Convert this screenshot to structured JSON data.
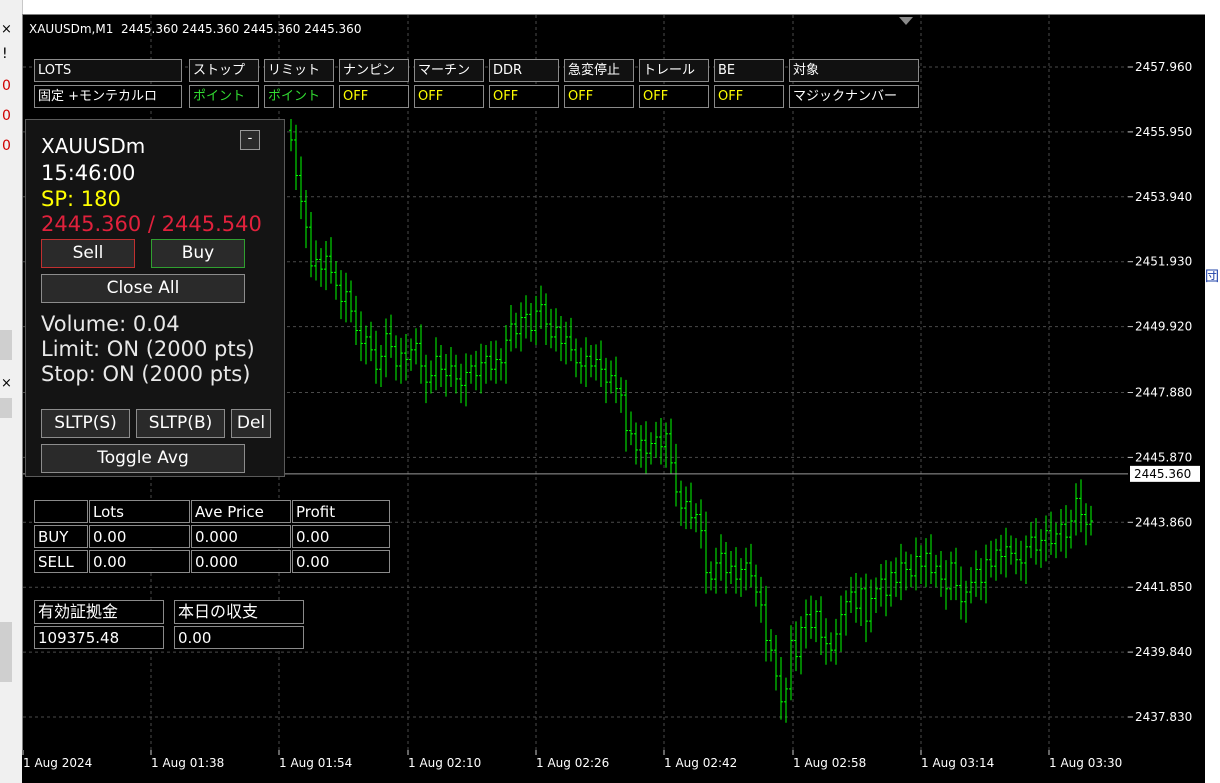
{
  "title_bar": "XAUUSDm,M1  2445.360 2445.360 2445.360 2445.360",
  "toolbar": [
    {
      "label": "LOTS",
      "value": "固定 +モンテカルロ",
      "value_color": "white"
    },
    {
      "label": "ストップ",
      "value": "ポイント",
      "value_color": "green"
    },
    {
      "label": "リミット",
      "value": "ポイント",
      "value_color": "green"
    },
    {
      "label": "ナンピン",
      "value": "OFF",
      "value_color": "yellow"
    },
    {
      "label": "マーチン",
      "value": "OFF",
      "value_color": "yellow"
    },
    {
      "label": "DDR",
      "value": "OFF",
      "value_color": "yellow"
    },
    {
      "label": "急変停止",
      "value": "OFF",
      "value_color": "yellow"
    },
    {
      "label": "トレール",
      "value": "OFF",
      "value_color": "yellow"
    },
    {
      "label": "BE",
      "value": "OFF",
      "value_color": "yellow"
    },
    {
      "label": "対象",
      "value": "マジックナンバー",
      "value_color": "white"
    }
  ],
  "panel": {
    "symbol": "XAUUSDm",
    "minimize_label": "-",
    "time": "15:46:00",
    "spread": "SP: 180",
    "bid_ask": "2445.360 / 2445.540",
    "sell_label": "Sell",
    "buy_label": "Buy",
    "close_all_label": "Close All",
    "volume": "Volume: 0.04",
    "limit": "Limit: ON (2000 pts)",
    "stop": "Stop: ON (2000 pts)",
    "sltp_s_label": "SLTP(S)",
    "sltp_b_label": "SLTP(B)",
    "del_label": "Del",
    "toggle_avg_label": "Toggle Avg"
  },
  "positions": {
    "headers": [
      "",
      "Lots",
      "Ave Price",
      "Profit"
    ],
    "rows": [
      [
        "BUY",
        "0.00",
        "0.000",
        "0.00"
      ],
      [
        "SELL",
        "0.00",
        "0.000",
        "0.00"
      ]
    ]
  },
  "account": {
    "margin_label": "有効証拠金",
    "margin_value": "109375.48",
    "pl_label": "本日の収支",
    "pl_value": "0.00"
  },
  "left_strip_fragments": [
    "!",
    "0",
    "0",
    "0"
  ],
  "right_strip_fragments": [
    "団"
  ],
  "colors": {
    "background": "#000000",
    "grid": "#4a4a4a",
    "bar": "#00ff00",
    "bid_line": "#9a9a9a",
    "price_tag_bg": "#ffffff",
    "sell_red": "#e0213c",
    "spread_yellow": "#ffff00"
  },
  "chart_data": {
    "type": "ohlc",
    "symbol": "XAUUSDm",
    "timeframe": "M1",
    "y_ticks": [
      2457.96,
      2455.95,
      2453.94,
      2451.93,
      2449.92,
      2447.88,
      2445.87,
      2443.86,
      2441.85,
      2439.84,
      2437.83
    ],
    "y_tick_labels": [
      "2457.960",
      "2455.950",
      "2453.940",
      "2451.930",
      "2449.920",
      "2447.880",
      "2445.870",
      "2443.860",
      "2441.850",
      "2439.840",
      "2437.830"
    ],
    "x_tick_labels": [
      "1 Aug 2024",
      "1 Aug 01:38",
      "1 Aug 01:54",
      "1 Aug 02:10",
      "1 Aug 02:26",
      "1 Aug 02:42",
      "1 Aug 02:58",
      "1 Aug 03:14",
      "1 Aug 03:30"
    ],
    "current_price": 2445.36,
    "current_price_label": "2445.360",
    "grid": true,
    "bar_closes": [
      2455.7,
      2454.6,
      2453.8,
      2453.0,
      2451.8,
      2452.0,
      2451.7,
      2452.1,
      2451.6,
      2451.2,
      2450.7,
      2451.0,
      2450.4,
      2449.8,
      2449.4,
      2449.6,
      2449.2,
      2448.6,
      2449.0,
      2449.7,
      2449.3,
      2448.7,
      2449.1,
      2448.9,
      2449.2,
      2449.4,
      2448.7,
      2448.2,
      2448.4,
      2449.0,
      2448.6,
      2448.4,
      2448.7,
      2448.3,
      2448.1,
      2448.5,
      2448.7,
      2448.4,
      2448.8,
      2449.0,
      2448.6,
      2448.9,
      2448.8,
      2449.5,
      2450.0,
      2449.7,
      2450.2,
      2450.3,
      2449.8,
      2450.4,
      2450.6,
      2450.0,
      2449.6,
      2449.9,
      2449.4,
      2449.6,
      2449.2,
      2448.8,
      2448.7,
      2449.0,
      2448.7,
      2448.9,
      2448.6,
      2448.2,
      2448.4,
      2448.0,
      2447.8,
      2446.7,
      2446.6,
      2446.1,
      2446.4,
      2446.0,
      2446.3,
      2446.5,
      2446.2,
      2446.6,
      2445.7,
      2444.8,
      2444.3,
      2444.5,
      2444.0,
      2444.1,
      2443.6,
      2442.3,
      2442.1,
      2442.6,
      2442.9,
      2442.3,
      2442.5,
      2442.1,
      2442.4,
      2442.6,
      2442.2,
      2441.7,
      2441.3,
      2440.2,
      2439.9,
      2439.1,
      2438.3,
      2438.7,
      2440.2,
      2439.7,
      2440.6,
      2441.0,
      2440.6,
      2441.1,
      2440.3,
      2440.1,
      2439.9,
      2440.4,
      2441.0,
      2441.4,
      2441.7,
      2441.2,
      2441.8,
      2440.8,
      2441.5,
      2441.8,
      2442.1,
      2441.6,
      2442.3,
      2442.0,
      2442.6,
      2442.4,
      2442.2,
      2442.8,
      2442.5,
      2442.9,
      2442.3,
      2442.5,
      2442.1,
      2441.8,
      2442.6,
      2441.9,
      2441.4,
      2441.7,
      2442.0,
      2442.4,
      2442.0,
      2442.7,
      2442.5,
      2443.0,
      2442.8,
      2443.1,
      2442.9,
      2442.7,
      2442.6,
      2443.1,
      2443.4,
      2443.0,
      2443.3,
      2443.6,
      2443.2,
      2443.5,
      2443.8,
      2443.4,
      2443.9,
      2444.6,
      2444.1,
      2443.8,
      2443.9
    ]
  }
}
